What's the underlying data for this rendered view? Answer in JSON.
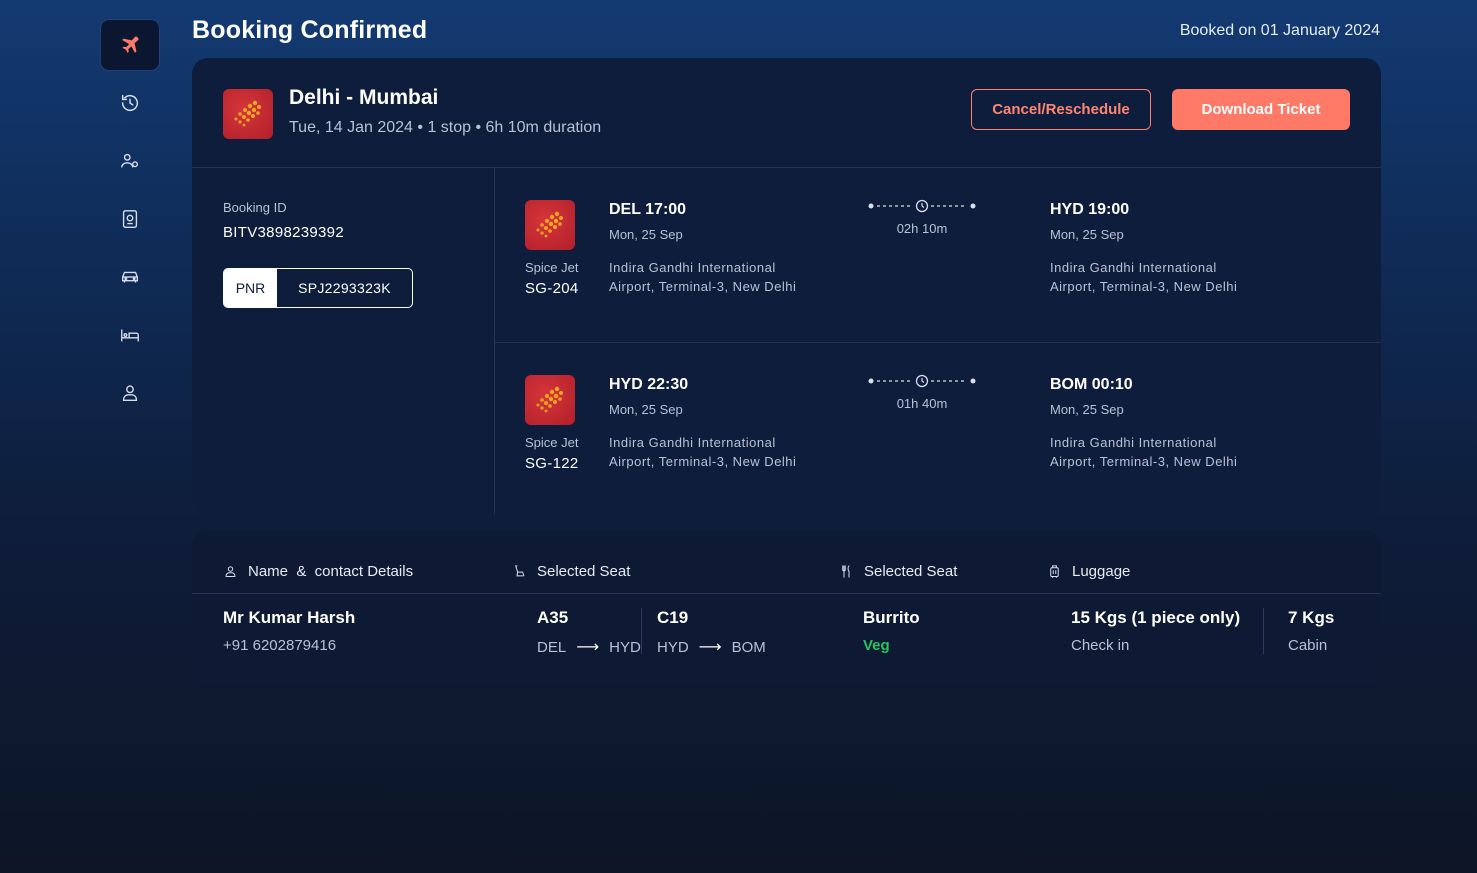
{
  "header": {
    "title": "Booking Confirmed",
    "booked_on": "Booked on 01 January 2024"
  },
  "sidebar": {
    "items": [
      {
        "name": "flights",
        "icon": "plane-icon",
        "active": true
      },
      {
        "name": "history",
        "icon": "history-icon"
      },
      {
        "name": "travellers",
        "icon": "users-icon"
      },
      {
        "name": "passport",
        "icon": "passport-icon"
      },
      {
        "name": "cabs",
        "icon": "car-icon"
      },
      {
        "name": "hotels",
        "icon": "bed-icon"
      },
      {
        "name": "profile",
        "icon": "user-icon"
      }
    ]
  },
  "trip": {
    "route": "Delhi - Mumbai",
    "meta": "Tue, 14 Jan 2024 • 1 stop • 6h 10m duration",
    "cancel_label": "Cancel/Reschedule",
    "download_label": "Download Ticket"
  },
  "booking": {
    "id_label": "Booking ID",
    "id_value": "BITV3898239392",
    "pnr_label": "PNR",
    "pnr_value": "SPJ2293323K"
  },
  "segments": [
    {
      "airline": "Spice Jet",
      "flight_no": "SG-204",
      "dep_time": "DEL 17:00",
      "dep_date": "Mon, 25 Sep",
      "dep_airport": "Indira Gandhi International Airport, Terminal-3, New Delhi",
      "duration": "02h 10m",
      "arr_time": "HYD 19:00",
      "arr_date": "Mon, 25 Sep",
      "arr_airport": "Indira Gandhi International Airport, Terminal-3, New Delhi"
    },
    {
      "airline": "Spice Jet",
      "flight_no": "SG-122",
      "dep_time": "HYD 22:30",
      "dep_date": "Mon, 25 Sep",
      "dep_airport": "Indira Gandhi International Airport, Terminal-3, New Delhi",
      "duration": "01h 40m",
      "arr_time": "BOM 00:10",
      "arr_date": "Mon, 25 Sep",
      "arr_airport": "Indira Gandhi International Airport, Terminal-3, New Delhi"
    }
  ],
  "passenger": {
    "headers": {
      "name": "Name  &  contact Details",
      "seat": "Selected Seat",
      "meal": "Selected Seat",
      "luggage": "Luggage"
    },
    "name": "Mr Kumar Harsh",
    "phone": "+91 6202879416",
    "seats": [
      {
        "seat": "A35",
        "from": "DEL",
        "to": "HYD"
      },
      {
        "seat": "C19",
        "from": "HYD",
        "to": "BOM"
      }
    ],
    "meal": "Burrito",
    "meal_type": "Veg",
    "checkin_weight": "15 Kgs (1 piece only)",
    "checkin_label": "Check in",
    "cabin_weight": "7 Kgs",
    "cabin_label": "Cabin"
  },
  "colors": {
    "accent": "#ff7a66",
    "veg": "#22c55e",
    "card": "#0e1d3c"
  }
}
